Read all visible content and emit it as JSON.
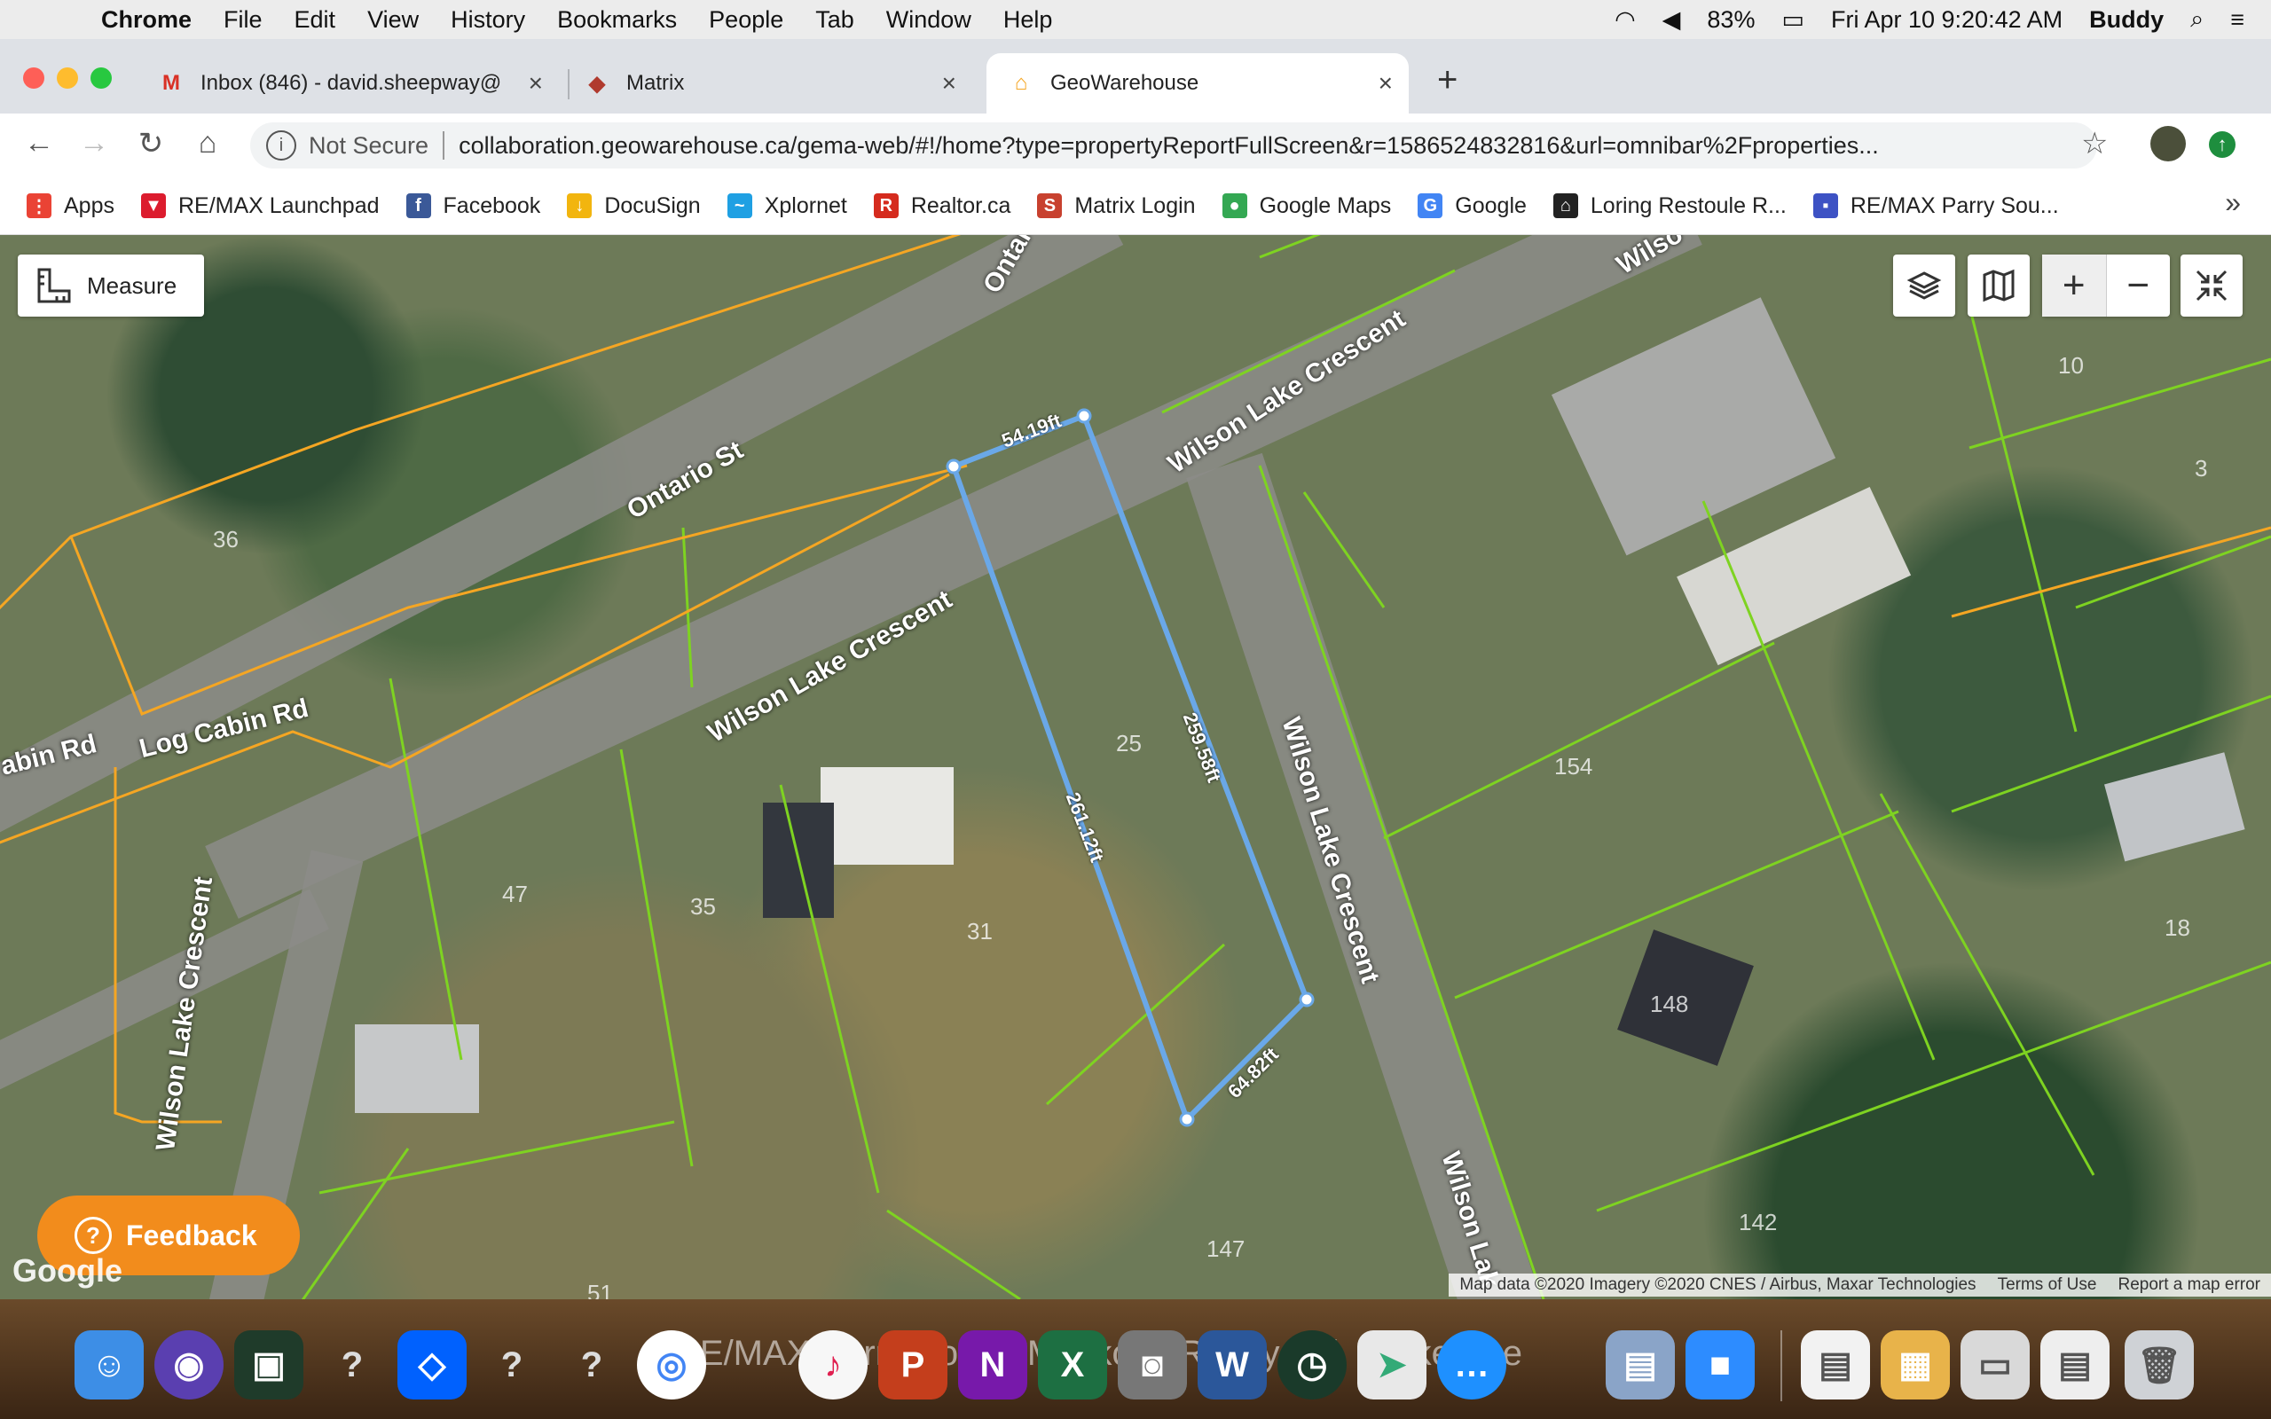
{
  "menubar": {
    "app": "Chrome",
    "items": [
      "File",
      "Edit",
      "View",
      "History",
      "Bookmarks",
      "People",
      "Tab",
      "Window",
      "Help"
    ],
    "battery": "83%",
    "datetime": "Fri Apr 10  9:20:42 AM",
    "user": "Buddy"
  },
  "tabs": [
    {
      "title": "Inbox (846) - david.sheepway@",
      "icon": "gmail-icon"
    },
    {
      "title": "Matrix",
      "icon": "matrix-icon"
    },
    {
      "title": "GeoWarehouse",
      "icon": "geowarehouse-icon",
      "active": true
    }
  ],
  "omnibox": {
    "security": "Not Secure",
    "url": "collaboration.geowarehouse.ca/gema-web/#!/home?type=propertyReportFullScreen&r=1586524832816&url=omnibar%2Fproperties..."
  },
  "bookmarks": [
    {
      "label": "Apps",
      "color": "#ea4335"
    },
    {
      "label": "RE/MAX Launchpad",
      "color": "#dc1c2e"
    },
    {
      "label": "Facebook",
      "color": "#3b5998"
    },
    {
      "label": "DocuSign",
      "color": "#f2b50f"
    },
    {
      "label": "Xplornet",
      "color": "#1fa0e3"
    },
    {
      "label": "Realtor.ca",
      "color": "#d52b1e"
    },
    {
      "label": "Matrix Login",
      "color": "#c8412f"
    },
    {
      "label": "Google Maps",
      "color": "#34a853"
    },
    {
      "label": "Google",
      "color": "#4285f4"
    },
    {
      "label": "Loring Restoule R...",
      "color": "#222222"
    },
    {
      "label": "RE/MAX Parry Sou...",
      "color": "#3d52c4"
    }
  ],
  "map": {
    "measure_label": "Measure",
    "streets": [
      "Ontario St",
      "Ontario",
      "Wilson Lake Crescent",
      "Wilson Lake Crescent",
      "Wilson Lake Crescent",
      "Wilson Lake Crescent",
      "Log Cabin Rd",
      "abin Rd",
      "Wilso",
      "Wilson Lak"
    ],
    "lot_numbers": [
      "36",
      "25",
      "31",
      "35",
      "47",
      "154",
      "148",
      "142",
      "147",
      "10",
      "3",
      "18",
      "51"
    ],
    "measurements": [
      "54.19ft",
      "259.58ft",
      "261.12ft",
      "64.82ft"
    ],
    "feedback_label": "Feedback",
    "google_logo": "Google",
    "attribution": [
      "Map data ©2020 Imagery ©2020 CNES / Airbus, Maxar Technologies",
      "Terms of Use",
      "Report a map error"
    ],
    "colors": {
      "measure_line": "#6aa8e8",
      "parcel": "#7ed321",
      "boundary": "#f5a623",
      "feedback": "#f28c1c"
    }
  },
  "dock": {
    "watermark": "RE/MAX Parry Sound Muskoka Realty Ltd, Brokerage"
  }
}
